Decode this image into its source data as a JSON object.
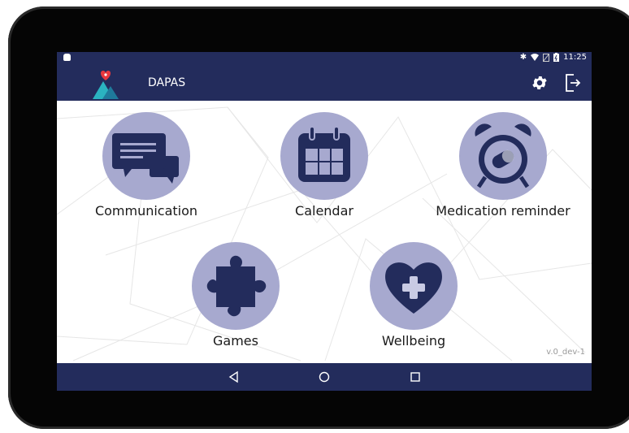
{
  "app": {
    "title": "DAPAS",
    "version": "v.0_dev-1"
  },
  "status_bar": {
    "time": "11:25",
    "icons": [
      "bluetooth-icon",
      "wifi-icon",
      "no-sim-icon",
      "battery-charging-icon"
    ]
  },
  "toolbar": {
    "settings_icon": "gear-icon",
    "logout_icon": "logout-icon"
  },
  "tiles": [
    {
      "label": "Communication",
      "icon": "chat-bubbles-icon"
    },
    {
      "label": "Calendar",
      "icon": "calendar-icon"
    },
    {
      "label": "Medication reminder",
      "icon": "alarm-clock-pill-icon"
    },
    {
      "label": "Games",
      "icon": "puzzle-piece-icon"
    },
    {
      "label": "Wellbeing",
      "icon": "heart-plus-icon"
    }
  ],
  "nav": {
    "back": "back-triangle-icon",
    "home": "home-circle-icon",
    "recents": "recents-square-icon"
  },
  "colors": {
    "bar": "#232c5c",
    "circle": "#a7a9cf",
    "icon": "#232c5c",
    "logo_red": "#e8373e",
    "logo_teal": "#2bb3c0"
  }
}
